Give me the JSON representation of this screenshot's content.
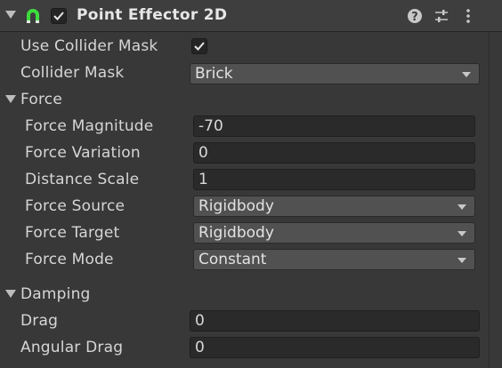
{
  "component": {
    "title": "Point Effector 2D",
    "enabled": true,
    "icons": [
      "magnet-icon",
      "help-icon",
      "preset-icon",
      "more-icon"
    ]
  },
  "properties": {
    "use_collider_mask": {
      "label": "Use Collider Mask",
      "checked": true
    },
    "collider_mask": {
      "label": "Collider Mask",
      "value": "Brick"
    }
  },
  "force": {
    "label": "Force",
    "magnitude": {
      "label": "Force Magnitude",
      "value": "-70"
    },
    "variation": {
      "label": "Force Variation",
      "value": "0"
    },
    "distance_scale": {
      "label": "Distance Scale",
      "value": "1"
    },
    "source": {
      "label": "Force Source",
      "value": "Rigidbody"
    },
    "target": {
      "label": "Force Target",
      "value": "Rigidbody"
    },
    "mode": {
      "label": "Force Mode",
      "value": "Constant"
    }
  },
  "damping": {
    "label": "Damping",
    "drag": {
      "label": "Drag",
      "value": "0"
    },
    "angular_drag": {
      "label": "Angular Drag",
      "value": "0"
    }
  },
  "colors": {
    "background": "#383838",
    "header": "#3e3e3e",
    "magnet": "#3ddc3d"
  }
}
